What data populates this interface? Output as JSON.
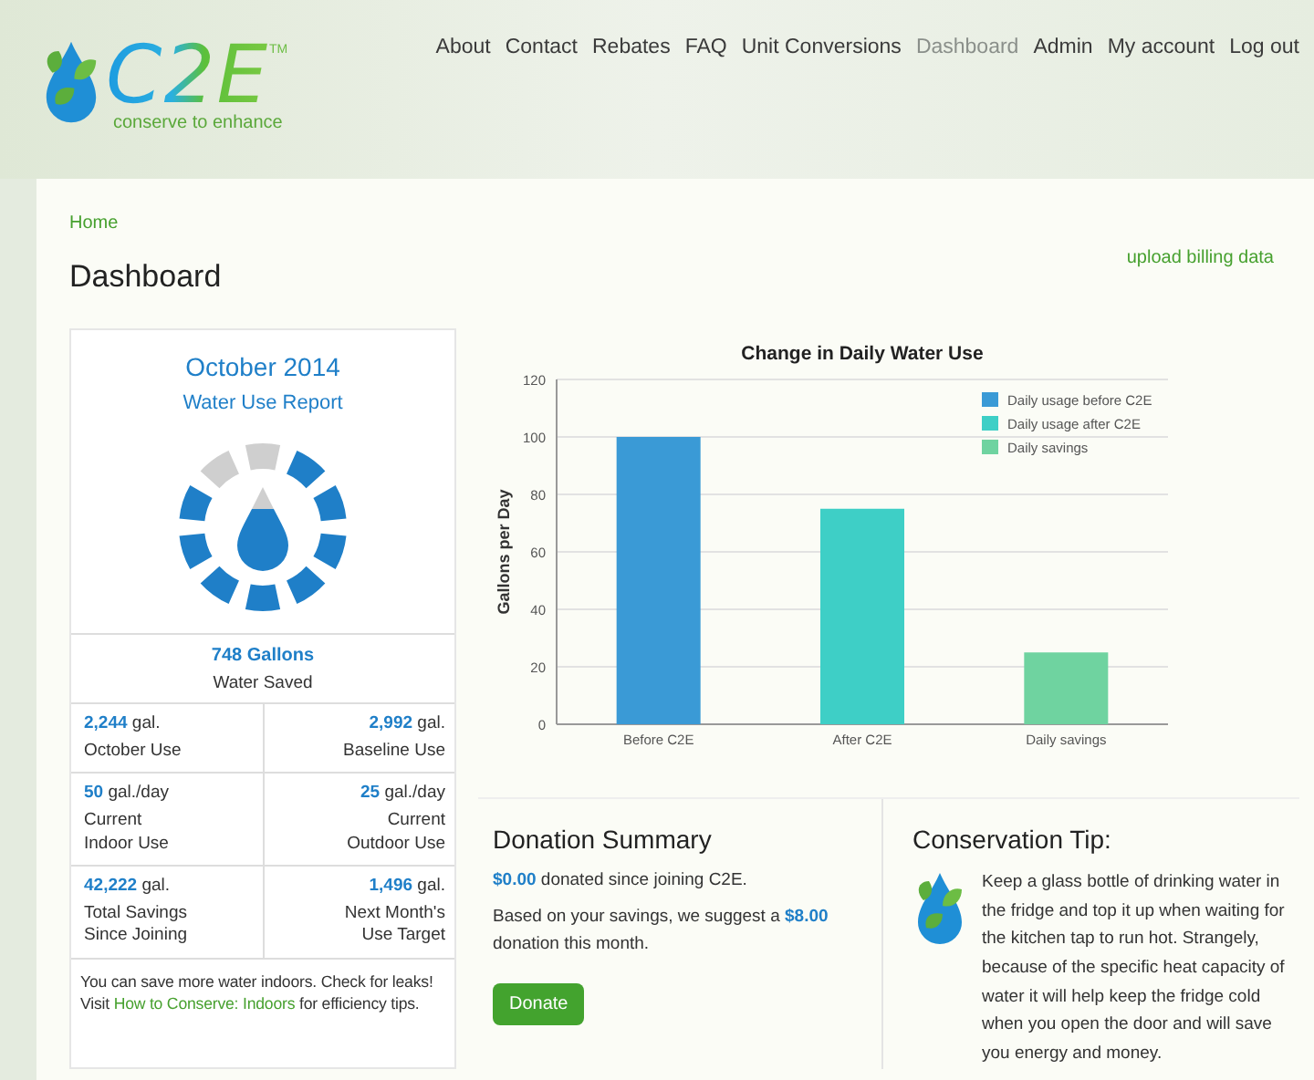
{
  "logo": {
    "wordmark": "C2E",
    "trademark": "TM",
    "tagline": "conserve to enhance"
  },
  "nav": [
    {
      "label": "About",
      "selected": false
    },
    {
      "label": "Contact",
      "selected": false
    },
    {
      "label": "Rebates",
      "selected": false
    },
    {
      "label": "FAQ",
      "selected": false
    },
    {
      "label": "Unit Conversions",
      "selected": false
    },
    {
      "label": "Dashboard",
      "selected": true
    },
    {
      "label": "Admin",
      "selected": false
    },
    {
      "label": "My account",
      "selected": false
    },
    {
      "label": "Log out",
      "selected": false
    }
  ],
  "breadcrumb": "Home",
  "page_title": "Dashboard",
  "upload_link": "upload billing data",
  "report": {
    "month": "October 2014",
    "subtitle": "Water Use Report",
    "saved": {
      "value": "748 Gallons",
      "label": "Water Saved"
    },
    "stats": [
      {
        "value": "2,244",
        "unit": " gal.",
        "label": "October Use"
      },
      {
        "value": "2,992",
        "unit": " gal.",
        "label": "Baseline Use"
      },
      {
        "value": "50",
        "unit": " gal./day",
        "label": "Current\nIndoor Use"
      },
      {
        "value": "25",
        "unit": " gal./day",
        "label": "Current\nOutdoor Use"
      },
      {
        "value": "42,222",
        "unit": " gal.",
        "label": "Total Savings\nSince Joining"
      },
      {
        "value": "1,496",
        "unit": " gal.",
        "label": "Next Month's\nUse Target"
      }
    ],
    "note": {
      "before": "You can save more water indoors. Check for leaks! Visit ",
      "link": "How to Conserve: Indoors",
      "after": " for efficiency tips."
    }
  },
  "chart": {
    "chart_data": {
      "type": "bar",
      "title": "Change in Daily Water Use",
      "ylabel": "Gallons per Day",
      "categories": [
        "Before C2E",
        "After C2E",
        "Daily savings"
      ],
      "stacked": true,
      "grid": true,
      "legend": true,
      "ylim": [
        0,
        120
      ],
      "yticks": [
        0,
        20,
        40,
        60,
        80,
        100,
        120
      ],
      "series": [
        {
          "name": "Daily usage before C2E",
          "color": "#3a9ad6",
          "values": [
            100,
            null,
            null
          ]
        },
        {
          "name": "Daily usage after C2E",
          "color": "#3ecfc6",
          "values": [
            null,
            75,
            null
          ]
        },
        {
          "name": "Daily savings",
          "color": "#6fd3a0",
          "values": [
            null,
            null,
            25
          ]
        }
      ]
    }
  },
  "donation": {
    "title": "Donation Summary",
    "donated": "**$0.00** donated since joining C2E.",
    "suggestion": "Based on your savings, we suggest a **$8.00** donation this month.",
    "button": "Donate"
  },
  "tip": {
    "title": "Conservation Tip:",
    "text": "Keep a glass bottle of drinking water in the fridge and top it up when waiting for the kitchen tap to run hot. Strangely, because of the specific heat capacity of water it will help keep the fridge cold when you open the door and will save you energy and money."
  }
}
